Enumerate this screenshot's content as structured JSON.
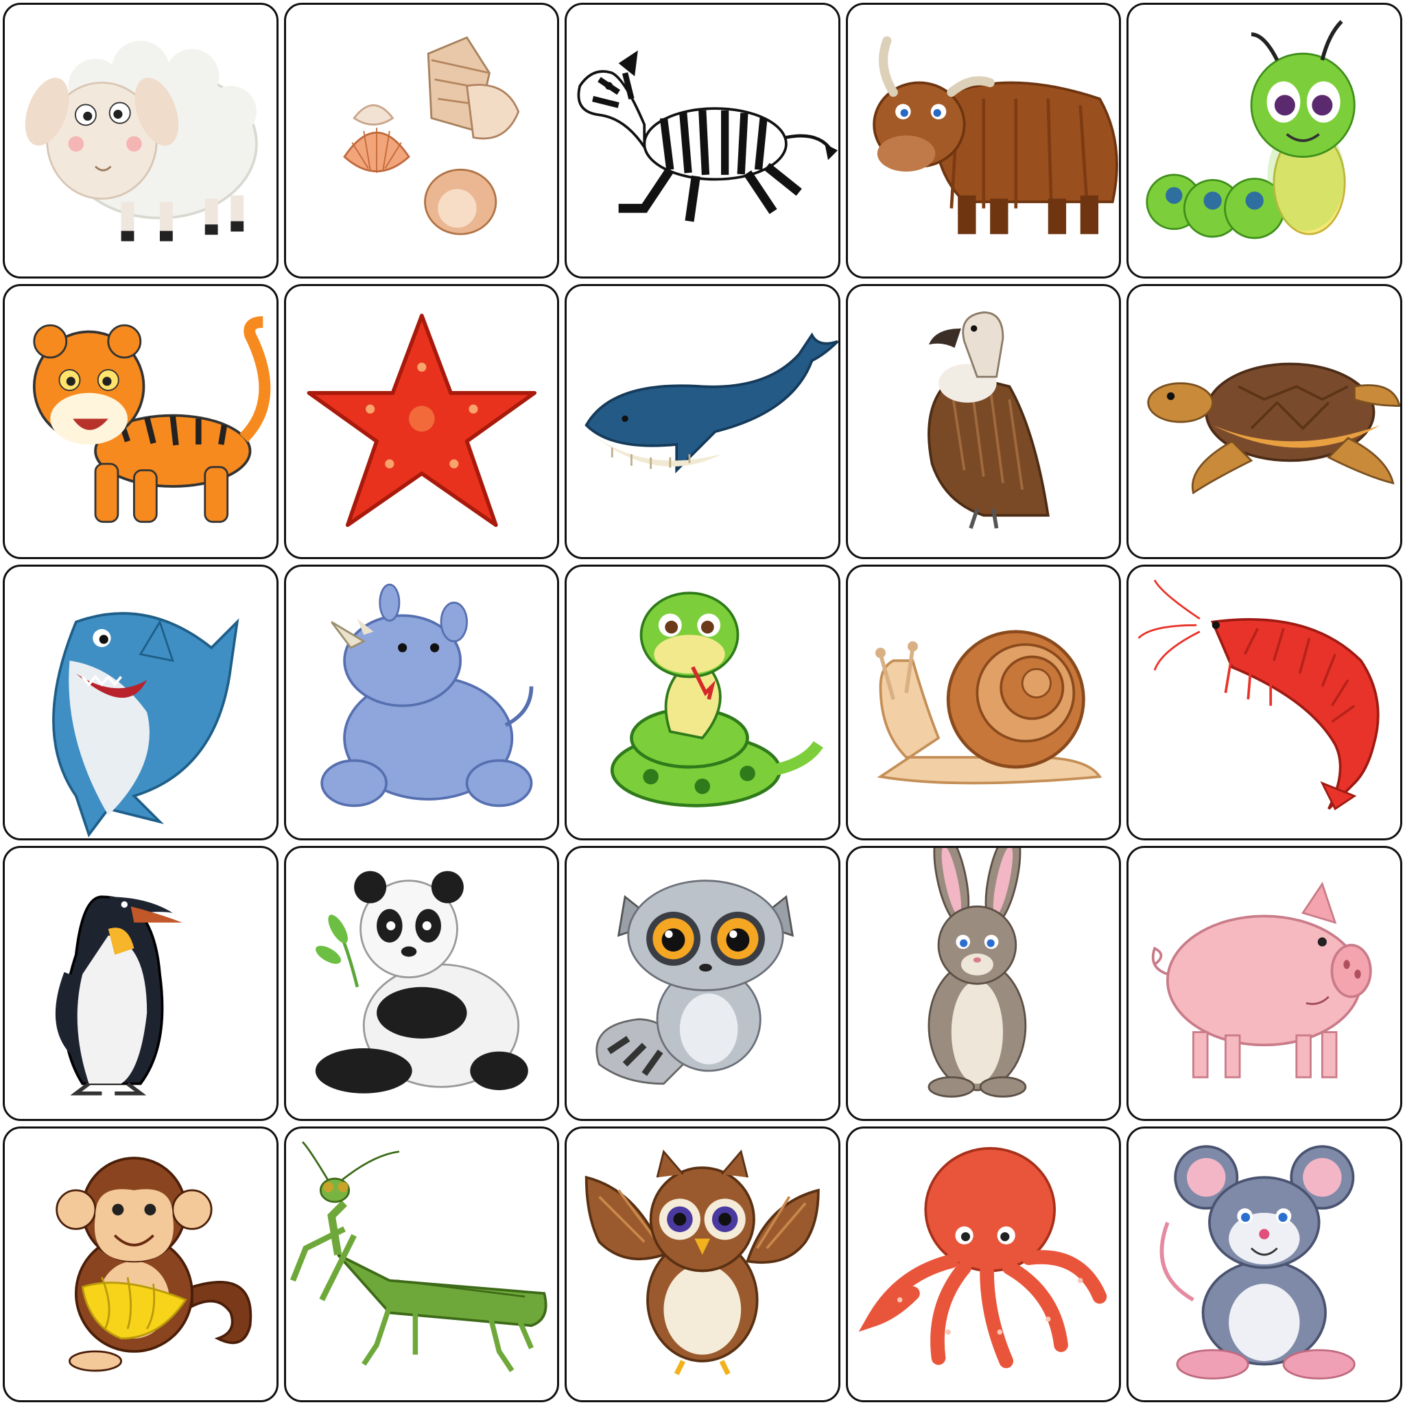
{
  "board": {
    "rows": 5,
    "cols": 5,
    "cards": [
      {
        "subject": "sheep",
        "icon": "sheep-icon"
      },
      {
        "subject": "seashells",
        "icon": "seashells-icon"
      },
      {
        "subject": "zebra",
        "icon": "zebra-icon"
      },
      {
        "subject": "yak",
        "icon": "yak-icon"
      },
      {
        "subject": "caterpillar",
        "icon": "caterpillar-icon"
      },
      {
        "subject": "tiger",
        "icon": "tiger-icon"
      },
      {
        "subject": "starfish",
        "icon": "starfish-icon"
      },
      {
        "subject": "whale",
        "icon": "whale-icon"
      },
      {
        "subject": "vulture",
        "icon": "vulture-icon"
      },
      {
        "subject": "turtle",
        "icon": "turtle-icon"
      },
      {
        "subject": "shark",
        "icon": "shark-icon"
      },
      {
        "subject": "rhino",
        "icon": "rhino-icon"
      },
      {
        "subject": "snake",
        "icon": "snake-icon"
      },
      {
        "subject": "snail",
        "icon": "snail-icon"
      },
      {
        "subject": "shrimp",
        "icon": "shrimp-icon"
      },
      {
        "subject": "penguin",
        "icon": "penguin-icon"
      },
      {
        "subject": "panda",
        "icon": "panda-icon"
      },
      {
        "subject": "raccoon",
        "icon": "raccoon-icon"
      },
      {
        "subject": "rabbit",
        "icon": "rabbit-icon"
      },
      {
        "subject": "pig",
        "icon": "pig-icon"
      },
      {
        "subject": "monkey",
        "icon": "monkey-icon"
      },
      {
        "subject": "mantis",
        "icon": "mantis-icon"
      },
      {
        "subject": "owl",
        "icon": "owl-icon"
      },
      {
        "subject": "octopus",
        "icon": "octopus-icon"
      },
      {
        "subject": "mouse",
        "icon": "mouse-icon"
      }
    ]
  },
  "colors": {
    "card_border": "#111111",
    "card_background": "#ffffff"
  }
}
